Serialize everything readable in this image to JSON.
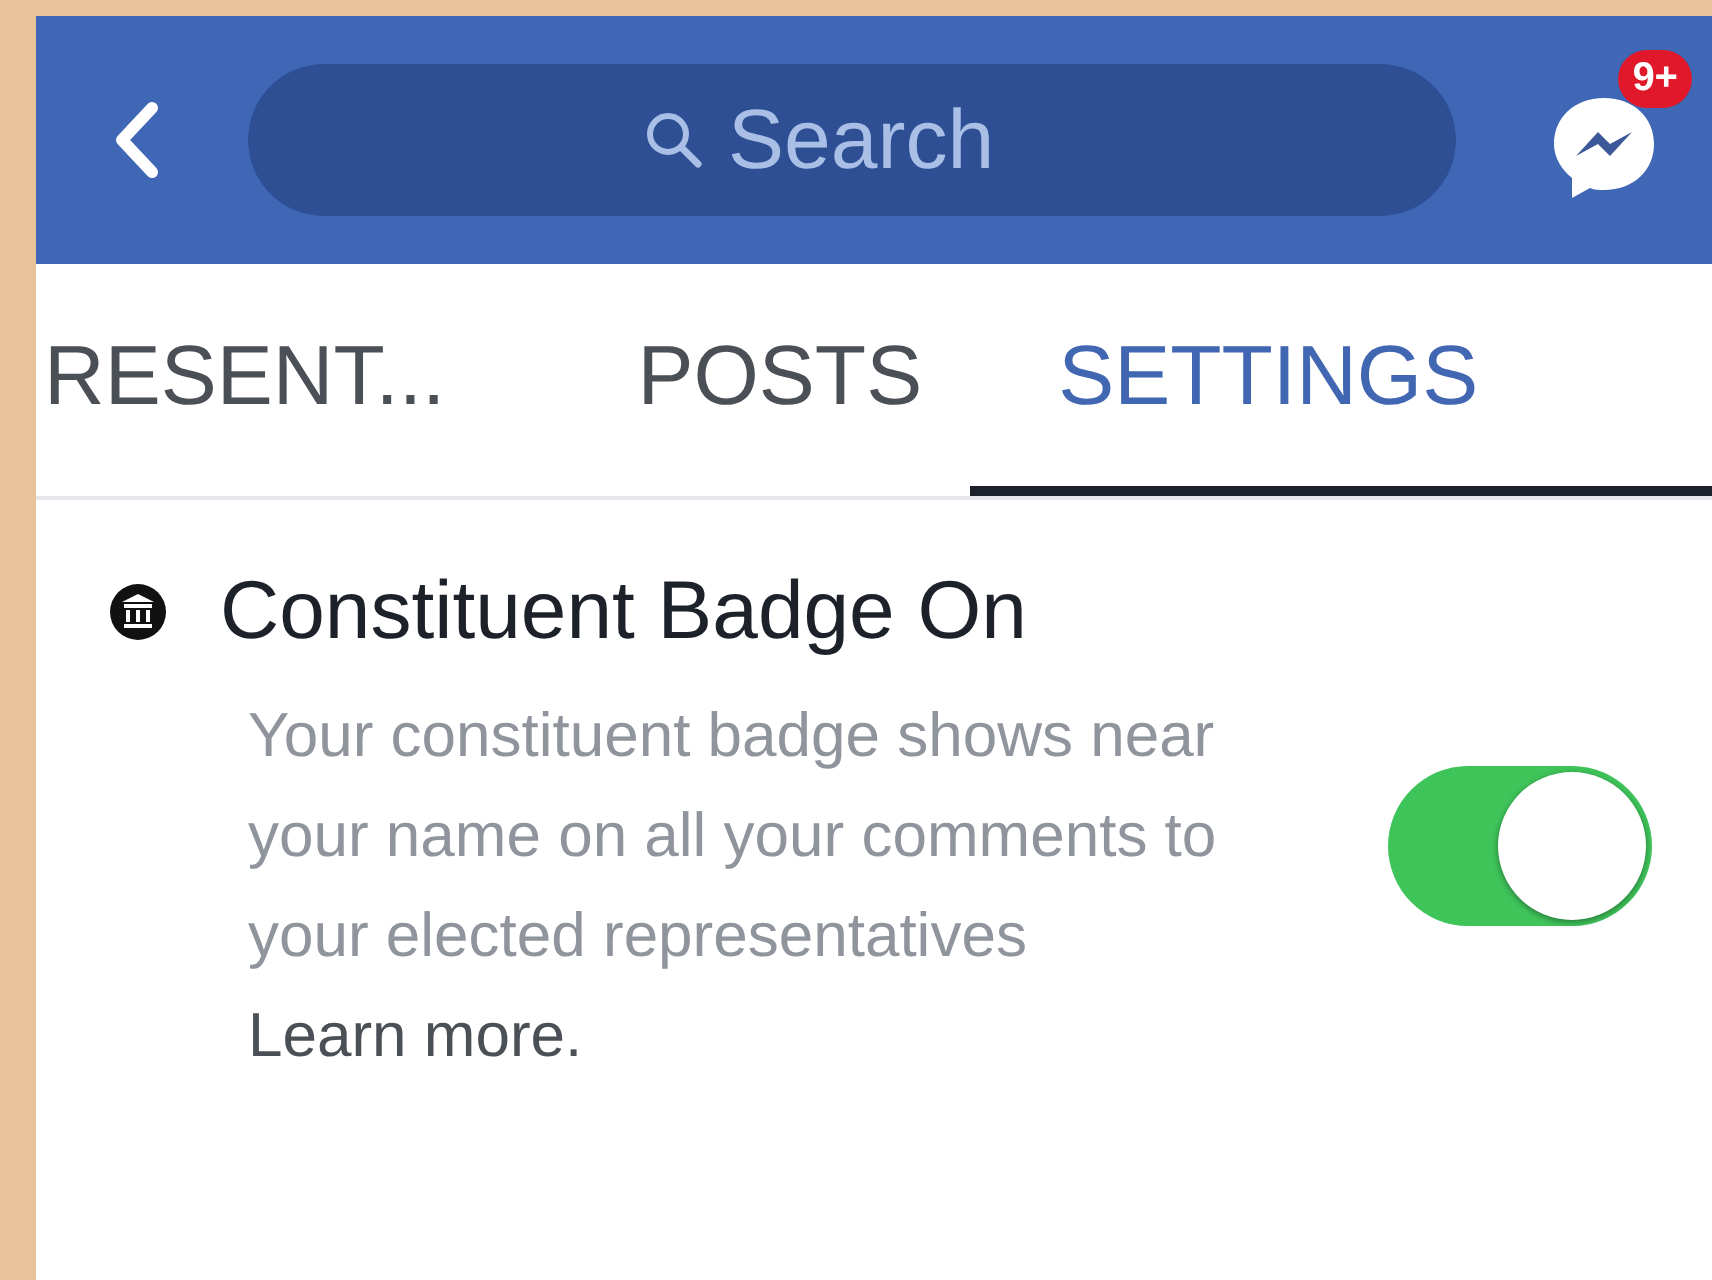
{
  "nav_bar": {
    "search": {
      "placeholder": "Search"
    },
    "messenger_badge": "9+"
  },
  "tabs": [
    {
      "label": "RESENT...",
      "selected": false
    },
    {
      "label": "POSTS",
      "selected": false
    },
    {
      "label": "SETTINGS",
      "selected": true
    }
  ],
  "setting": {
    "title": "Constituent Badge On",
    "description": "Your constituent badge shows near your name on all your comments to your elected representatives",
    "link": "Learn more.",
    "on": true
  }
}
